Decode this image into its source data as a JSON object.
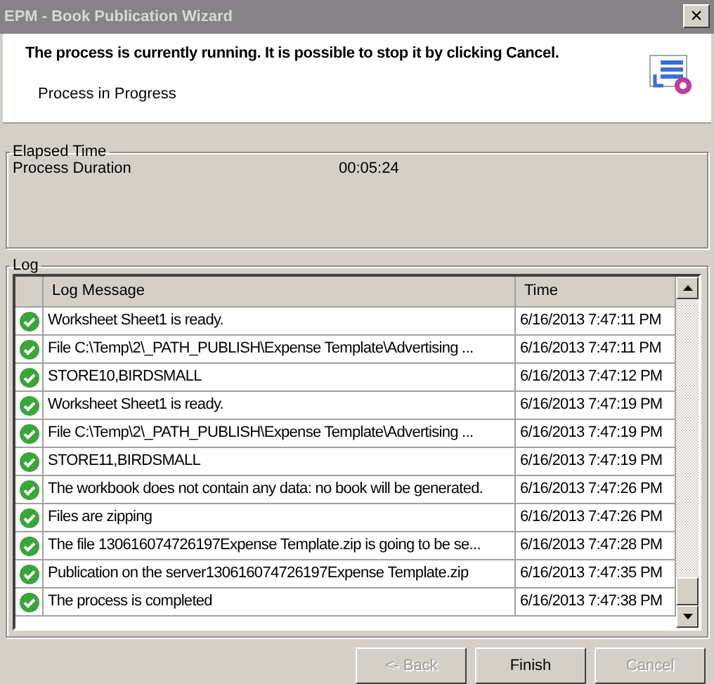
{
  "window": {
    "title": "EPM - Book Publication Wizard",
    "close": "×"
  },
  "header": {
    "message": "The process is currently running. It is possible to stop it by clicking Cancel.",
    "status": "Process in Progress"
  },
  "elapsed": {
    "title": "Elapsed Time",
    "label": "Process Duration",
    "value": "00:05:24"
  },
  "log": {
    "title": "Log",
    "columns": [
      "Log Message",
      "Time"
    ],
    "rows": [
      {
        "kind": "success",
        "message": "Worksheet Sheet1 is ready.",
        "time": "6/16/2013 7:47:11 PM"
      },
      {
        "kind": "success",
        "message": "File C:\\Temp\\2\\_PATH_PUBLISH\\Expense Template\\Advertising ...",
        "time": "6/16/2013 7:47:11 PM"
      },
      {
        "kind": "success",
        "message": "STORE10,BIRDSMALL",
        "time": "6/16/2013 7:47:12 PM"
      },
      {
        "kind": "success",
        "message": "Worksheet Sheet1 is ready.",
        "time": "6/16/2013 7:47:19 PM"
      },
      {
        "kind": "success",
        "message": "File C:\\Temp\\2\\_PATH_PUBLISH\\Expense Template\\Advertising ...",
        "time": "6/16/2013 7:47:19 PM"
      },
      {
        "kind": "success",
        "message": "STORE11,BIRDSMALL",
        "time": "6/16/2013 7:47:19 PM"
      },
      {
        "kind": "success",
        "message": "The workbook does not contain any data: no book will be generated.",
        "time": "6/16/2013 7:47:26 PM"
      },
      {
        "kind": "success",
        "message": "Files are zipping",
        "time": "6/16/2013 7:47:26 PM"
      },
      {
        "kind": "success",
        "message": "The file 130616074726197Expense Template.zip is going to be se...",
        "time": "6/16/2013 7:47:28 PM"
      },
      {
        "kind": "success",
        "message": "Publication on the server130616074726197Expense Template.zip",
        "time": "6/16/2013 7:47:35 PM"
      },
      {
        "kind": "success",
        "message": "The process is completed",
        "time": "6/16/2013 7:47:38 PM"
      }
    ]
  },
  "buttons": [
    {
      "label": "<- Back",
      "disabled": true
    },
    {
      "label": "Finish",
      "disabled": false
    },
    {
      "label": "Cancel",
      "disabled": true
    }
  ]
}
